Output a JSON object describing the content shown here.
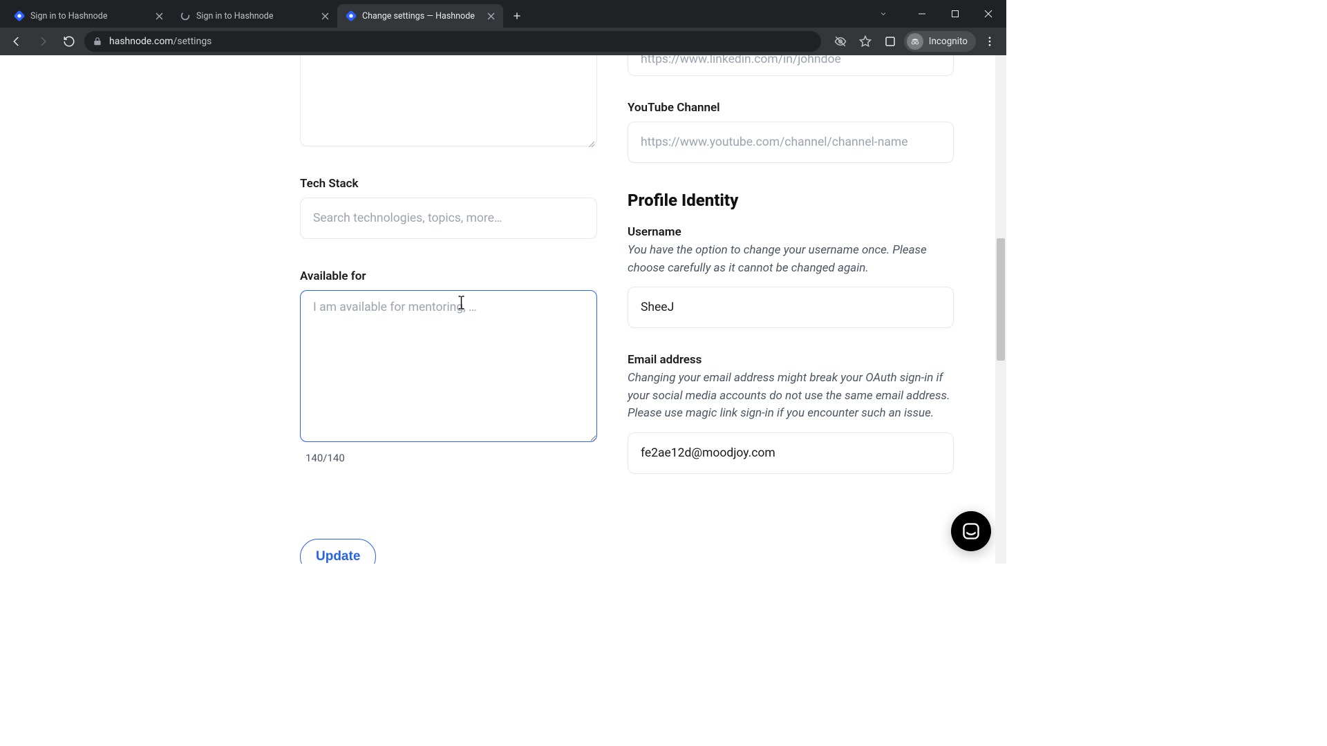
{
  "browser": {
    "tabs": [
      {
        "title": "Sign in to Hashnode",
        "active": false,
        "favicon": "hashnode"
      },
      {
        "title": "Sign in to Hashnode",
        "active": false,
        "favicon": "spinner"
      },
      {
        "title": "Change settings — Hashnode",
        "active": true,
        "favicon": "hashnode"
      }
    ],
    "url_host": "hashnode.com",
    "url_path": "/settings",
    "incognito_label": "Incognito"
  },
  "left": {
    "tech_stack_label": "Tech Stack",
    "tech_stack_placeholder": "Search technologies, topics, more…",
    "available_label": "Available for",
    "available_placeholder": "I am available for mentoring, …",
    "available_counter": "140/140",
    "update_label": "Update"
  },
  "right": {
    "linkedin_placeholder": "https://www.linkedin.com/in/johndoe",
    "youtube_label": "YouTube Channel",
    "youtube_placeholder": "https://www.youtube.com/channel/channel-name",
    "identity_heading": "Profile Identity",
    "username_label": "Username",
    "username_helper": "You have the option to change your username once. Please choose carefully as it cannot be changed again.",
    "username_value": "SheeJ",
    "email_label": "Email address",
    "email_helper": "Changing your email address might break your OAuth sign-in if your social media accounts do not use the same email address. Please use magic link sign-in if you encounter such an issue.",
    "email_value": "fe2ae12d@moodjoy.com"
  }
}
